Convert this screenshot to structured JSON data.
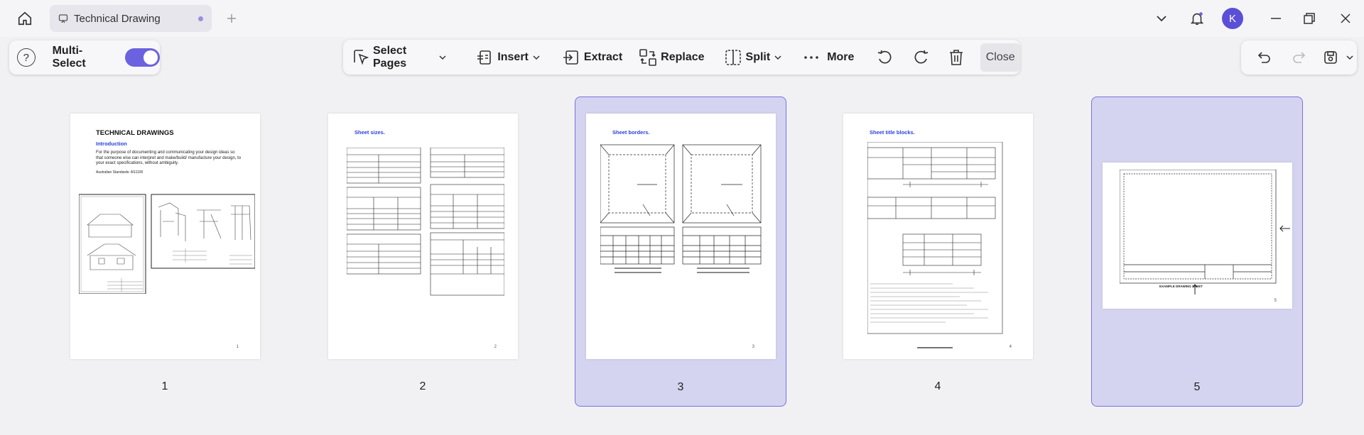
{
  "titlebar": {
    "tab_title": "Technical Drawing",
    "avatar_initial": "K",
    "avatar_color": "#5b4fd8"
  },
  "toolbar": {
    "help": "?",
    "multi_select_label": "Multi-Select",
    "multi_select_on": true,
    "select_pages": "Select Pages",
    "insert": "Insert",
    "extract": "Extract",
    "replace": "Replace",
    "split": "Split",
    "more": "More",
    "close": "Close"
  },
  "accent_color": "#6b62e0",
  "pages": [
    {
      "number": "1",
      "selected": false,
      "heading": "TECHNICAL DRAWINGS",
      "subheading": "Introduction",
      "body": "For the purpose of documenting and communicating your design ideas so that someone else can interpret and make/build/ manufacture your design, to your exact specifications, without ambiguity.",
      "footnote": "Australian Standards: AS1100",
      "corner": "1"
    },
    {
      "number": "2",
      "selected": false,
      "heading": "Sheet sizes.",
      "corner": "2"
    },
    {
      "number": "3",
      "selected": true,
      "heading": "Sheet borders.",
      "corner": "3"
    },
    {
      "number": "4",
      "selected": false,
      "heading": "Sheet title blocks.",
      "corner": "4"
    },
    {
      "number": "5",
      "selected": true,
      "caption": "EXAMPLE DRAWING SHEET",
      "corner": "5"
    }
  ]
}
